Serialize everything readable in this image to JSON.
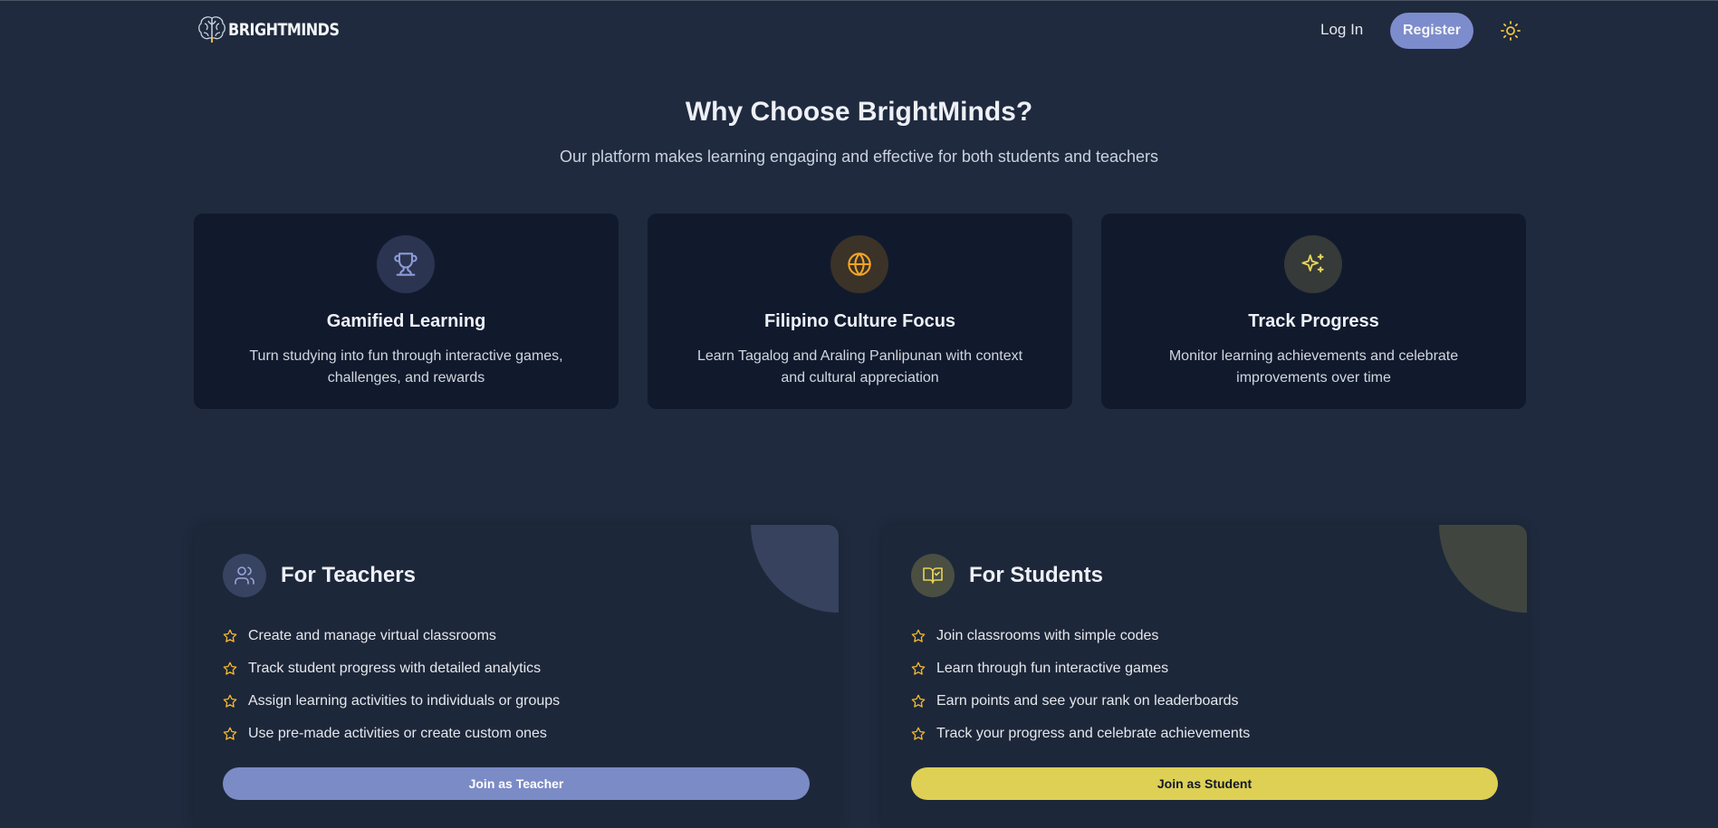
{
  "header": {
    "brand": "BRIGHTMINDS",
    "login_label": "Log In",
    "register_label": "Register",
    "theme_icon": "sun-icon"
  },
  "why": {
    "title": "Why Choose BrightMinds?",
    "subtitle": "Our platform makes learning engaging and effective for both students and teachers",
    "features": [
      {
        "icon": "trophy-icon",
        "title": "Gamified Learning",
        "description": "Turn studying into fun through interactive games, challenges, and rewards"
      },
      {
        "icon": "globe-icon",
        "title": "Filipino Culture Focus",
        "description": "Learn Tagalog and Araling Panlipunan with context and cultural appreciation"
      },
      {
        "icon": "sparkles-icon",
        "title": "Track Progress",
        "description": "Monitor learning achievements and celebrate improvements over time"
      }
    ]
  },
  "teachers": {
    "icon": "users-icon",
    "title": "For Teachers",
    "items": [
      "Create and manage virtual classrooms",
      "Track student progress with detailed analytics",
      "Assign learning activities to individuals or groups",
      "Use pre-made activities or create custom ones"
    ],
    "button_label": "Join as Teacher"
  },
  "students": {
    "icon": "book-check-icon",
    "title": "For Students",
    "items": [
      "Join classrooms with simple codes",
      "Learn through fun interactive games",
      "Earn points and see your rank on leaderboards",
      "Track your progress and celebrate achievements"
    ],
    "button_label": "Join as Student"
  },
  "colors": {
    "background": "#1f2a3e",
    "card": "#111a2d",
    "primary": "#7c8ccc",
    "accent_yellow": "#ddd055",
    "star": "#f5b82e"
  }
}
